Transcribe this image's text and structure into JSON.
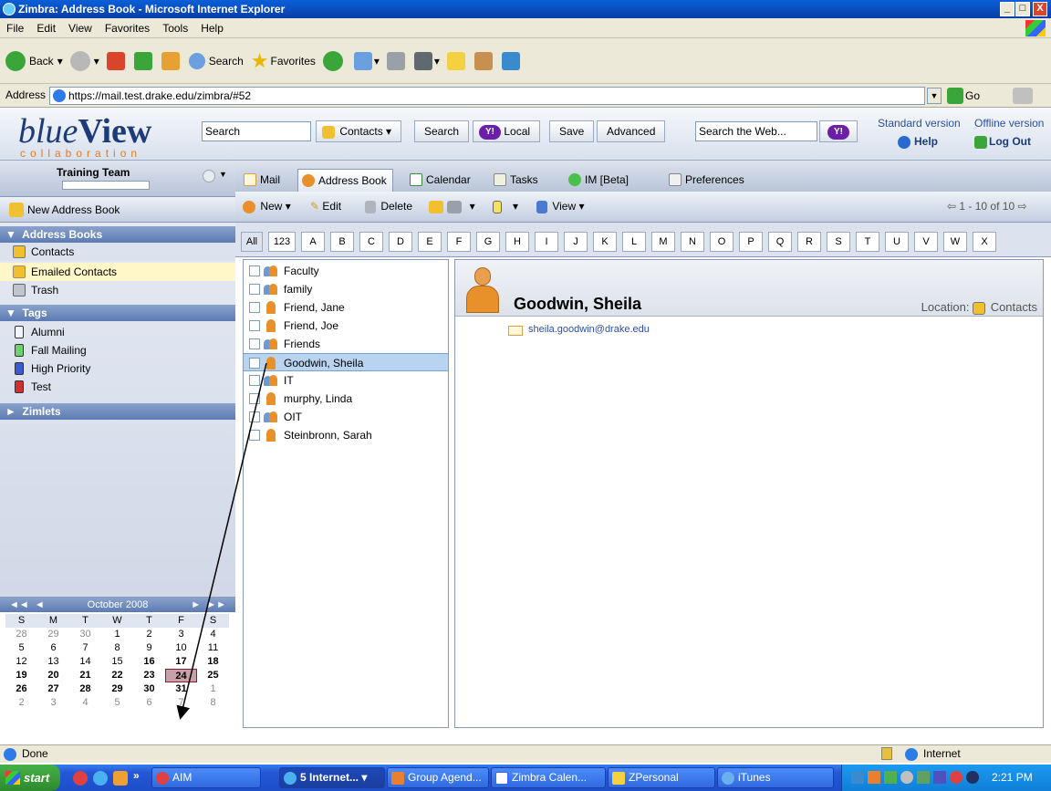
{
  "window": {
    "title": "Zimbra: Address Book - Microsoft Internet Explorer",
    "min": "_",
    "max": "□",
    "close": "X"
  },
  "menu": [
    "File",
    "Edit",
    "View",
    "Favorites",
    "Tools",
    "Help"
  ],
  "toolbar": {
    "back": "Back",
    "search": "Search",
    "favorites": "Favorites"
  },
  "address": {
    "label": "Address",
    "value": "https://mail.test.drake.edu/zimbra/#52",
    "go": "Go"
  },
  "header": {
    "logo_main": "blue",
    "logo_main2": "View",
    "logo_sub": "collaboration",
    "search_value": "Search",
    "contacts_dd": "Contacts",
    "search_btn": "Search",
    "local_btn": "Local",
    "save_btn": "Save",
    "advanced_btn": "Advanced",
    "web_search_placeholder": "Search the Web...",
    "yahoo": "Y!",
    "standard": "Standard version",
    "offline": "Offline version",
    "help": "Help",
    "logout": "Log Out"
  },
  "left": {
    "team": "Training Team",
    "new_ab": "New Address Book",
    "address_books_head": "Address Books",
    "address_books": [
      "Contacts",
      "Emailed Contacts",
      "Trash"
    ],
    "tags_head": "Tags",
    "tags": [
      "Alumni",
      "Fall Mailing",
      "High Priority",
      "Test"
    ],
    "zimlets_head": "Zimlets"
  },
  "calendar": {
    "month": "October 2008",
    "days": [
      "S",
      "M",
      "T",
      "W",
      "T",
      "F",
      "S"
    ],
    "weeks": [
      [
        "28",
        "29",
        "30",
        "1",
        "2",
        "3",
        "4"
      ],
      [
        "5",
        "6",
        "7",
        "8",
        "9",
        "10",
        "11"
      ],
      [
        "12",
        "13",
        "14",
        "15",
        "16",
        "17",
        "18"
      ],
      [
        "19",
        "20",
        "21",
        "22",
        "23",
        "24",
        "25"
      ],
      [
        "26",
        "27",
        "28",
        "29",
        "30",
        "31",
        "1"
      ],
      [
        "2",
        "3",
        "4",
        "5",
        "6",
        "7",
        "8"
      ]
    ]
  },
  "tabs": [
    "Mail",
    "Address Book",
    "Calendar",
    "Tasks",
    "IM [Beta]",
    "Preferences"
  ],
  "actions": {
    "new": "New",
    "edit": "Edit",
    "delete": "Delete",
    "view": "View",
    "paging": "1 - 10 of 10"
  },
  "alpha": [
    "All",
    "123",
    "A",
    "B",
    "C",
    "D",
    "E",
    "F",
    "G",
    "H",
    "I",
    "J",
    "K",
    "L",
    "M",
    "N",
    "O",
    "P",
    "Q",
    "R",
    "S",
    "T",
    "U",
    "V",
    "W",
    "X"
  ],
  "contacts": [
    "Faculty",
    "family",
    "Friend, Jane",
    "Friend, Joe",
    "Friends",
    "Goodwin, Sheila",
    "IT",
    "murphy, Linda",
    "OIT",
    "Steinbronn, Sarah"
  ],
  "detail": {
    "name": "Goodwin, Sheila",
    "location_label": "Location:",
    "location": "Contacts",
    "email": "sheila.goodwin@drake.edu"
  },
  "status": {
    "text": "Done",
    "zone": "Internet"
  },
  "taskbar": {
    "start": "start",
    "items": [
      "AIM",
      "5 Internet...",
      "Group Agend...",
      "Zimbra Calen...",
      "ZPersonal",
      "iTunes"
    ],
    "time": "2:21 PM"
  },
  "colors": {
    "accent": "#1c3b78",
    "selected_row": "#b8d4f0",
    "today": "#c8a0a8"
  }
}
